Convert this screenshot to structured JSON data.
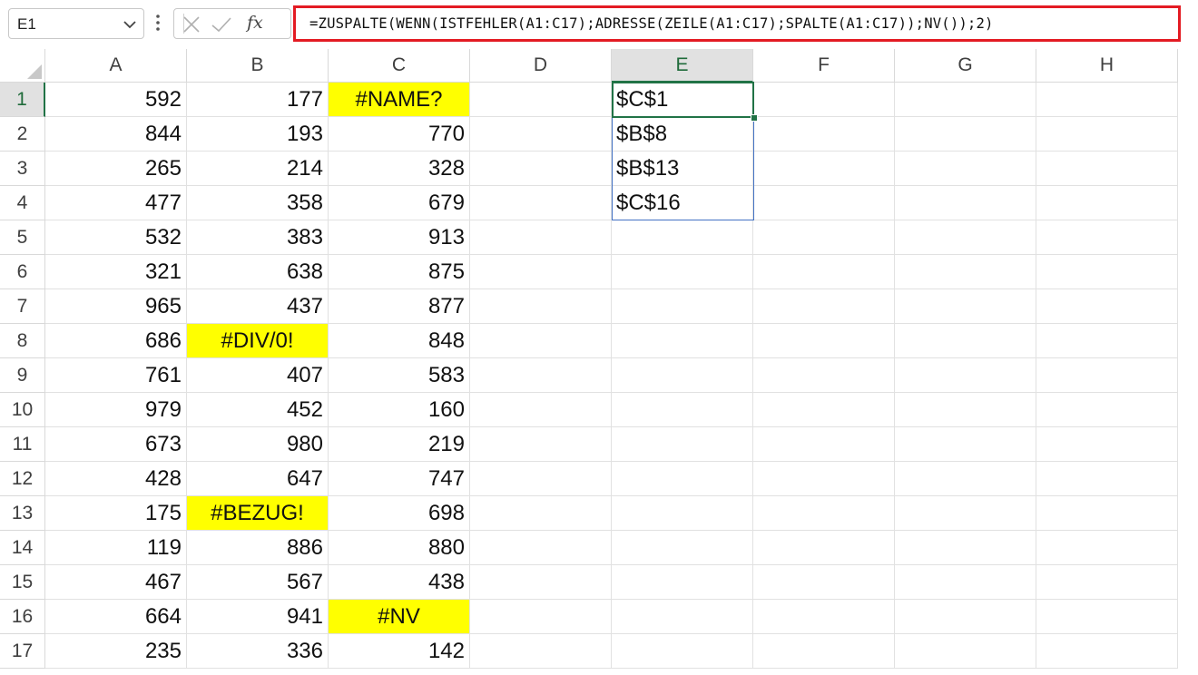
{
  "name_box": {
    "value": "E1",
    "dropdown_icon": "chevron-down-icon"
  },
  "toolbar": {
    "more_icon": "vertical-ellipsis-icon",
    "cancel_icon": "x-icon",
    "enter_icon": "checkmark-icon",
    "fx_label": "fx"
  },
  "formula": {
    "text": "=ZUSPALTE(WENN(ISTFEHLER(A1:C17);ADRESSE(ZEILE(A1:C17);SPALTE(A1:C17));NV());2)"
  },
  "colors": {
    "accent": "#217346",
    "highlight": "#ffff00",
    "formula_border": "#e31b23",
    "spill_border": "#4472c4"
  },
  "sheet": {
    "columns": [
      "A",
      "B",
      "C",
      "D",
      "E",
      "F",
      "G",
      "H"
    ],
    "selected_column": "E",
    "selected_row": "1",
    "rows": [
      {
        "num": "1",
        "a": "592",
        "b": "177",
        "c": "#NAME?",
        "e": "$C$1"
      },
      {
        "num": "2",
        "a": "844",
        "b": "193",
        "c": "770",
        "e": "$B$8"
      },
      {
        "num": "3",
        "a": "265",
        "b": "214",
        "c": "328",
        "e": "$B$13"
      },
      {
        "num": "4",
        "a": "477",
        "b": "358",
        "c": "679",
        "e": "$C$16"
      },
      {
        "num": "5",
        "a": "532",
        "b": "383",
        "c": "913"
      },
      {
        "num": "6",
        "a": "321",
        "b": "638",
        "c": "875"
      },
      {
        "num": "7",
        "a": "965",
        "b": "437",
        "c": "877"
      },
      {
        "num": "8",
        "a": "686",
        "b": "#DIV/0!",
        "c": "848"
      },
      {
        "num": "9",
        "a": "761",
        "b": "407",
        "c": "583"
      },
      {
        "num": "10",
        "a": "979",
        "b": "452",
        "c": "160"
      },
      {
        "num": "11",
        "a": "673",
        "b": "980",
        "c": "219"
      },
      {
        "num": "12",
        "a": "428",
        "b": "647",
        "c": "747"
      },
      {
        "num": "13",
        "a": "175",
        "b": "#BEZUG!",
        "c": "698"
      },
      {
        "num": "14",
        "a": "119",
        "b": "886",
        "c": "880"
      },
      {
        "num": "15",
        "a": "467",
        "b": "567",
        "c": "438"
      },
      {
        "num": "16",
        "a": "664",
        "b": "941",
        "c": "#NV"
      },
      {
        "num": "17",
        "a": "235",
        "b": "336",
        "c": "142"
      }
    ]
  }
}
